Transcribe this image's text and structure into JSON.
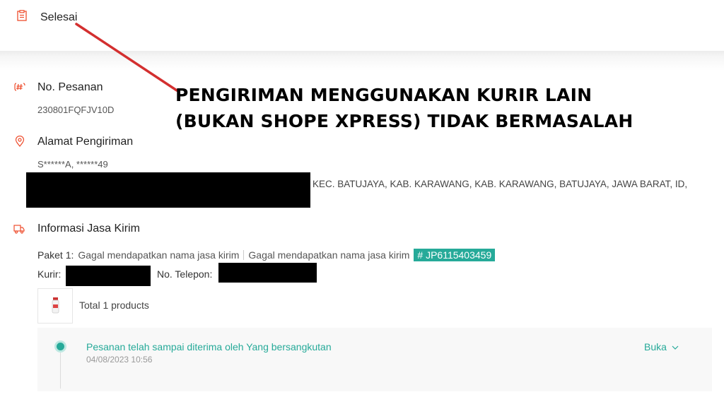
{
  "status": {
    "label": "Selesai"
  },
  "order": {
    "title": "No. Pesanan",
    "number": "230801FQFJV10D"
  },
  "address": {
    "title": "Alamat Pengiriman",
    "recipient": "S******A, ******49",
    "tail": "KEC. BATUJAYA, KAB. KARAWANG, KAB. KARAWANG, BATUJAYA, JAWA BARAT, ID,"
  },
  "shipping": {
    "title": "Informasi Jasa Kirim",
    "package_label": "Paket 1:",
    "service_name": "Gagal mendapatkan nama jasa kirim",
    "service_name_2": "Gagal mendapatkan nama jasa kirim",
    "tracking": "# JP6115403459",
    "courier_label": "Kurir:",
    "phone_label": "No. Telepon:"
  },
  "products": {
    "summary": "Total 1 products"
  },
  "timeline": {
    "status": "Pesanan telah sampai diterima oleh Yang bersangkutan",
    "time": "04/08/2023 10:56",
    "open_label": "Buka"
  },
  "annotation": {
    "line1": "PENGIRIMAN MENGGUNAKAN KURIR LAIN",
    "line2": "(BUKAN SHOPE XPRESS) TIDAK BERMASALAH"
  },
  "colors": {
    "accent": "#26aa99",
    "icon": "#ee4d2d",
    "arrow": "#d32f2f"
  }
}
